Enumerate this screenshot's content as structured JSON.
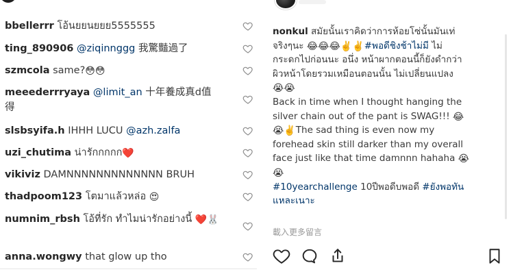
{
  "left_panel": {
    "comments": [
      {
        "username": "bbellerrr",
        "text": "โอ้นยยนยยย5555555"
      },
      {
        "username": "ting_890906",
        "mention": "@ziqinnggg",
        "text": "我驚豔過了"
      },
      {
        "username": "szmcola",
        "text": "same?",
        "emoji": "😳😳"
      },
      {
        "username": "meeederrryaya",
        "mention": "@limit_an",
        "text": "十年養成真d值得"
      },
      {
        "username": "slsbsyifa.h",
        "text": "IHHH LUCU",
        "mention": "@azh.zalfa"
      },
      {
        "username": "uzi_chutima",
        "text": "น่ารักกกกก",
        "emoji": "❤️"
      },
      {
        "username": "vikiviz",
        "text": "DAMNNNNNNNNNNNNN BRUH"
      },
      {
        "username": "thadpoom123",
        "text": "โตมาแล้วหล่อ",
        "emoji": "😍"
      },
      {
        "username": "numnim_rbsh",
        "text": "โอ้ที่รัก ทำไมน่ารักอย่างนี้",
        "emoji": "❤️🐰"
      },
      {
        "username": "anna.wongwy",
        "text": "that glow up tho"
      }
    ]
  },
  "right_panel": {
    "caption": {
      "username": "nonkul",
      "lines": [
        {
          "text": "สมัยนั้นเราคิดว่าการห้อยโซ่นั้นมันเท่"
        },
        {
          "text": "จริงๆนะ",
          "emoji": "😂😂😂✌️✌️",
          "hashtag": "#พอดีชิงช้าไม่มี",
          "tail": "ไม่"
        },
        {
          "text": "กระดกไปก่อนนะ อนึ่ง หน้าผากตอนนี้ก็ยังดำกว่า"
        },
        {
          "text": "ผิวหน้าโดยรวมเหมือนตอนนั้น ไม่เปลี่ยนแปลง"
        },
        {
          "emoji": "😭😭"
        },
        {
          "text": "Back in time when I thought hanging the"
        },
        {
          "text": "silver chain out of the pant is SWAG!!!",
          "emoji": "😂"
        },
        {
          "emoji": "😭✌️",
          "text": "The sad thing is even now my"
        },
        {
          "text": "forehead skin still darker than my overall"
        },
        {
          "text": "face just like that time damnnn hahaha",
          "emoji": "😭"
        },
        {
          "emoji": "😭"
        },
        {
          "hashtag": "#10yearchallenge",
          "text": "10ปีพอดีบพอดี",
          "hashtag2": "#ยังพอทัน"
        },
        {
          "hashtag": "แหละเนาะ"
        }
      ]
    },
    "load_more_label": "載入更多留言",
    "actions": [
      "heart-icon",
      "comment-icon",
      "share-icon",
      "bookmark-icon"
    ]
  },
  "colors": {
    "text": "#262626",
    "mention": "#003569",
    "muted": "#999999",
    "divider": "#e6e6e6"
  }
}
